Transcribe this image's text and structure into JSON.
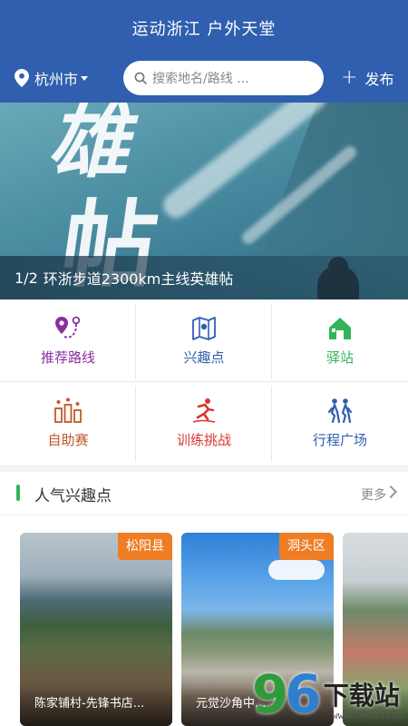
{
  "header": {
    "title": "运动浙江 户外天堂",
    "city": "杭州市",
    "search_placeholder": "搜索地名/路线 ...",
    "publish_label": "发布",
    "bg_color": "#2f5fae"
  },
  "banner": {
    "calligraphy_1": "雄",
    "calligraphy_2": "帖",
    "page_indicator": "1/2",
    "caption": "环浙步道2300km主线英雄帖"
  },
  "menu": {
    "items": [
      {
        "label": "推荐路线",
        "icon": "route-pin-icon",
        "color": "#8a2fa0"
      },
      {
        "label": "兴趣点",
        "icon": "map-icon",
        "color": "#2f5fae"
      },
      {
        "label": "驿站",
        "icon": "station-icon",
        "color": "#33b35a"
      },
      {
        "label": "自助赛",
        "icon": "race-icon",
        "color": "#c0582a"
      },
      {
        "label": "训练挑战",
        "icon": "runner-icon",
        "color": "#d9362b"
      },
      {
        "label": "行程广场",
        "icon": "hikers-icon",
        "color": "#2f5fae"
      }
    ]
  },
  "popular": {
    "title": "人气兴趣点",
    "more_label": "更多",
    "accent": "#33b35a",
    "cards": [
      {
        "tag": "松阳县",
        "name": "陈家铺村-先锋书店..."
      },
      {
        "tag": "洞头区",
        "name": "元觉沙角中..."
      },
      {
        "tag": "",
        "name": ""
      }
    ]
  },
  "watermark": {
    "num_1": "9",
    "num_2": "6",
    "text": "下载站",
    "url": "www.96xz.com"
  }
}
